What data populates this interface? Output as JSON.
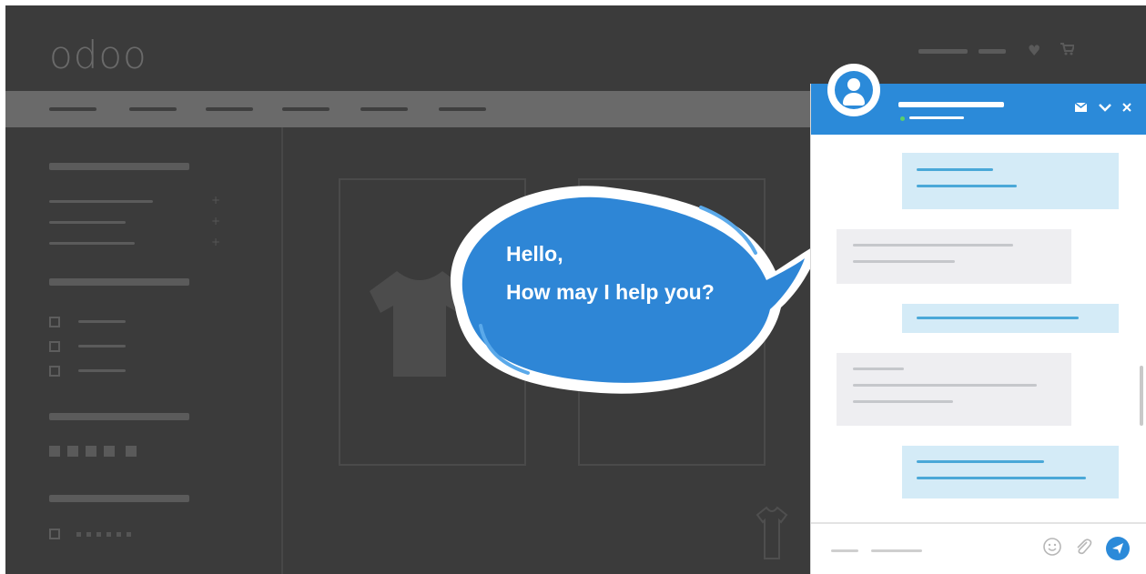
{
  "site": {
    "logo": "odoo",
    "header_icons": [
      "heart-icon",
      "cart-icon"
    ]
  },
  "bubble": {
    "line1": "Hello,",
    "line2": "How may I help you?"
  },
  "chat": {
    "status": "online",
    "header_actions": [
      "mail-icon",
      "minimize-icon",
      "close-icon"
    ],
    "footer_actions": [
      "emoji-icon",
      "attachment-icon",
      "send-icon"
    ]
  },
  "colors": {
    "accent": "#2b8ad9",
    "background": "#3b3b3b",
    "outgoing_message": "#d4ebf7",
    "incoming_message": "#eeeef1",
    "status_online": "#5bd06a"
  }
}
